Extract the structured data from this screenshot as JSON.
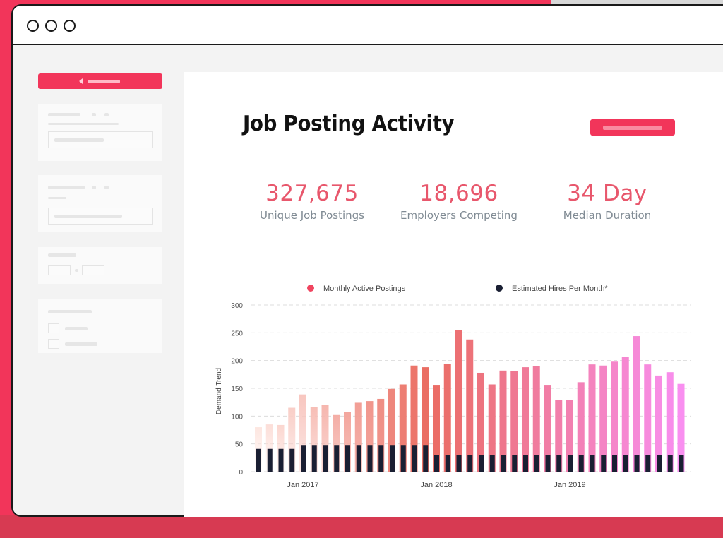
{
  "window": {
    "controls": [
      "window-dot",
      "window-dot",
      "window-dot"
    ]
  },
  "page": {
    "title": "Job Posting Activity"
  },
  "stats": [
    {
      "value": "327,675",
      "label": "Unique Job Postings"
    },
    {
      "value": "18,696",
      "label": "Employers Competing"
    },
    {
      "value": "34 Day",
      "label": "Median Duration"
    }
  ],
  "colors": {
    "accent": "#f2355a",
    "stat_value": "#e8576c",
    "hires": "#1a1f33",
    "bar_start": "#fde6e0",
    "bar_mid": "#ea6c61",
    "bar_end": "#f98ff0"
  },
  "chart_data": {
    "type": "bar",
    "legend": [
      {
        "name": "Monthly Active Postings",
        "color": "#f0445f"
      },
      {
        "name": "Estimated Hires Per Month*",
        "color": "#1a1f33"
      }
    ],
    "legend_position": "top",
    "ylabel": "Demand Trend",
    "ylim": [
      0,
      300
    ],
    "yticks": [
      0,
      50,
      100,
      150,
      200,
      250,
      300
    ],
    "grid": true,
    "x_tick_labels": [
      {
        "label": "Jan 2017",
        "index": 4
      },
      {
        "label": "Jan 2018",
        "index": 16
      },
      {
        "label": "Jan 2019",
        "index": 28
      }
    ],
    "series": [
      {
        "name": "Monthly Active Postings",
        "values": [
          80,
          85,
          84,
          115,
          139,
          116,
          120,
          102,
          108,
          124,
          127,
          131,
          149,
          157,
          191,
          188,
          155,
          194,
          255,
          238,
          178,
          157,
          182,
          181,
          188,
          190,
          155,
          129,
          129,
          161,
          193,
          191,
          198,
          206,
          244,
          193,
          173,
          179,
          158
        ]
      },
      {
        "name": "Estimated Hires Per Month*",
        "values": [
          41,
          41,
          41,
          41,
          48,
          48,
          48,
          48,
          48,
          48,
          48,
          48,
          48,
          48,
          48,
          48,
          30,
          30,
          30,
          30,
          30,
          30,
          30,
          30,
          30,
          30,
          30,
          30,
          30,
          30,
          30,
          30,
          30,
          30,
          30,
          30,
          30,
          30,
          30
        ]
      }
    ]
  }
}
